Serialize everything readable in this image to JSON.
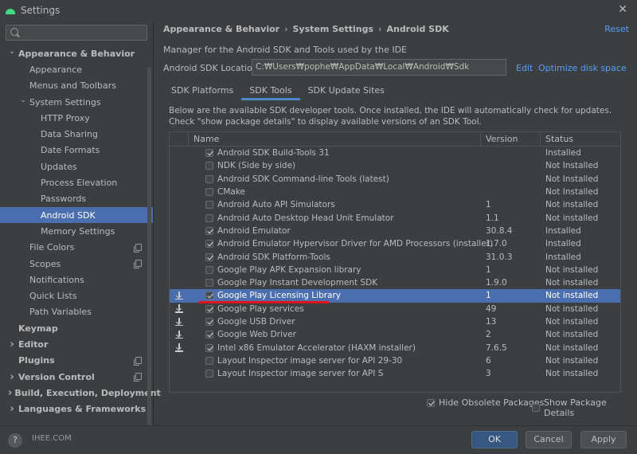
{
  "window": {
    "title": "Settings"
  },
  "sidebar": {
    "search_placeholder": "",
    "items": [
      {
        "label": "Appearance & Behavior",
        "level": 0,
        "arrow": "down",
        "bold": true
      },
      {
        "label": "Appearance",
        "level": 1
      },
      {
        "label": "Menus and Toolbars",
        "level": 1
      },
      {
        "label": "System Settings",
        "level": 1,
        "arrow": "down"
      },
      {
        "label": "HTTP Proxy",
        "level": 2
      },
      {
        "label": "Data Sharing",
        "level": 2
      },
      {
        "label": "Date Formats",
        "level": 2
      },
      {
        "label": "Updates",
        "level": 2
      },
      {
        "label": "Process Elevation",
        "level": 2
      },
      {
        "label": "Passwords",
        "level": 2
      },
      {
        "label": "Android SDK",
        "level": 2,
        "selected": true
      },
      {
        "label": "Memory Settings",
        "level": 2
      },
      {
        "label": "File Colors",
        "level": 1,
        "copy": true
      },
      {
        "label": "Scopes",
        "level": 1,
        "copy": true
      },
      {
        "label": "Notifications",
        "level": 1
      },
      {
        "label": "Quick Lists",
        "level": 1
      },
      {
        "label": "Path Variables",
        "level": 1
      },
      {
        "label": "Keymap",
        "level": 0,
        "bold": true
      },
      {
        "label": "Editor",
        "level": 0,
        "arrow": "right",
        "bold": true
      },
      {
        "label": "Plugins",
        "level": 0,
        "bold": true,
        "copy": true
      },
      {
        "label": "Version Control",
        "level": 0,
        "arrow": "right",
        "bold": true,
        "copy": true
      },
      {
        "label": "Build, Execution, Deployment",
        "level": 0,
        "arrow": "right",
        "bold": true
      },
      {
        "label": "Languages & Frameworks",
        "level": 0,
        "arrow": "right",
        "bold": true
      }
    ]
  },
  "breadcrumb": [
    "Appearance & Behavior",
    "System Settings",
    "Android SDK"
  ],
  "breadcrumb_sep": "›",
  "reset_label": "Reset",
  "description": "Manager for the Android SDK and Tools used by the IDE",
  "sdk_location": {
    "label": "Android SDK Location:",
    "value": "C:₩Users₩pophe₩AppData₩Local₩Android₩Sdk",
    "edit_label": "Edit",
    "optimize_label": "Optimize disk space"
  },
  "tabs": [
    {
      "label": "SDK Platforms",
      "active": false
    },
    {
      "label": "SDK Tools",
      "active": true
    },
    {
      "label": "SDK Update Sites",
      "active": false
    }
  ],
  "info_text": [
    "Below are the available SDK developer tools. Once installed, the IDE will automatically check for updates.",
    "Check \"show package details\" to display available versions of an SDK Tool."
  ],
  "table": {
    "columns": [
      "Name",
      "Version",
      "Status"
    ],
    "rows": [
      {
        "name": "Android SDK Build-Tools 31",
        "version": "",
        "status": "Installed",
        "checked": true,
        "download": false
      },
      {
        "name": "NDK (Side by side)",
        "version": "",
        "status": "Not Installed",
        "checked": false,
        "download": false
      },
      {
        "name": "Android SDK Command-line Tools (latest)",
        "version": "",
        "status": "Not Installed",
        "checked": false,
        "download": false
      },
      {
        "name": "CMake",
        "version": "",
        "status": "Not Installed",
        "checked": false,
        "download": false
      },
      {
        "name": "Android Auto API Simulators",
        "version": "1",
        "status": "Not installed",
        "checked": false,
        "download": false
      },
      {
        "name": "Android Auto Desktop Head Unit Emulator",
        "version": "1.1",
        "status": "Not installed",
        "checked": false,
        "download": false
      },
      {
        "name": "Android Emulator",
        "version": "30.8.4",
        "status": "Installed",
        "checked": true,
        "download": false
      },
      {
        "name": "Android Emulator Hypervisor Driver for AMD Processors (installer)",
        "version": "1.7.0",
        "status": "Installed",
        "checked": true,
        "download": false
      },
      {
        "name": "Android SDK Platform-Tools",
        "version": "31.0.3",
        "status": "Installed",
        "checked": true,
        "download": false
      },
      {
        "name": "Google Play APK Expansion library",
        "version": "1",
        "status": "Not installed",
        "checked": false,
        "download": false
      },
      {
        "name": "Google Play Instant Development SDK",
        "version": "1.9.0",
        "status": "Not installed",
        "checked": false,
        "download": false
      },
      {
        "name": "Google Play Licensing Library",
        "version": "1",
        "status": "Not installed",
        "checked": true,
        "download": true,
        "selected": true
      },
      {
        "name": "Google Play services",
        "version": "49",
        "status": "Not installed",
        "checked": true,
        "download": true
      },
      {
        "name": "Google USB Driver",
        "version": "13",
        "status": "Not installed",
        "checked": true,
        "download": true
      },
      {
        "name": "Google Web Driver",
        "version": "2",
        "status": "Not installed",
        "checked": true,
        "download": true
      },
      {
        "name": "Intel x86 Emulator Accelerator (HAXM installer)",
        "version": "7.6.5",
        "status": "Not installed",
        "checked": true,
        "download": true
      },
      {
        "name": "Layout Inspector image server for API 29-30",
        "version": "6",
        "status": "Not installed",
        "checked": false,
        "download": false
      },
      {
        "name": "Layout Inspector image server for API S",
        "version": "3",
        "status": "Not installed",
        "checked": false,
        "download": false
      }
    ]
  },
  "options": {
    "hide_obsolete_label": "Hide Obsolete Packages",
    "hide_obsolete_checked": true,
    "show_details_label": "Show Package Details",
    "show_details_checked": false
  },
  "footer": {
    "help_label": "?",
    "watermark": "IHEE.COM",
    "ok_label": "OK",
    "cancel_label": "Cancel",
    "apply_label": "Apply"
  },
  "colors": {
    "background": "#3c3f41",
    "selection": "#4b6eaf",
    "link": "#589df6",
    "annotation_underline": "#e0161e"
  }
}
